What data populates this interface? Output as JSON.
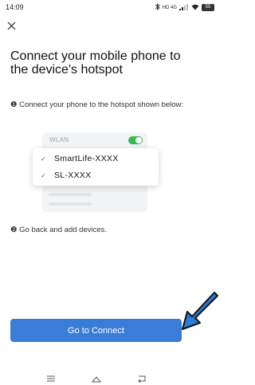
{
  "status_bar": {
    "time": "14:09",
    "indicators": "HD 4G",
    "battery": "55"
  },
  "header": {
    "close_icon": "close-icon"
  },
  "title": "Connect your mobile phone to the device's hotspot",
  "steps": [
    {
      "number": "❶",
      "text": "Connect your phone to the hotspot shown below:"
    },
    {
      "number": "❷",
      "text": "Go back and add devices."
    }
  ],
  "illustration": {
    "wlan_label": "WLAN",
    "wlan_toggle_on": true,
    "networks": [
      "SmartLife-XXXX",
      "SL-XXXX"
    ]
  },
  "cta": {
    "label": "Go to Connect"
  },
  "colors": {
    "accent": "#3a7dd8",
    "toggle": "#2fbb4f",
    "arrow": "#2a7ad6"
  },
  "nav": {
    "menu_icon": "menu-icon",
    "home_icon": "home-icon",
    "back_icon": "back-icon"
  }
}
